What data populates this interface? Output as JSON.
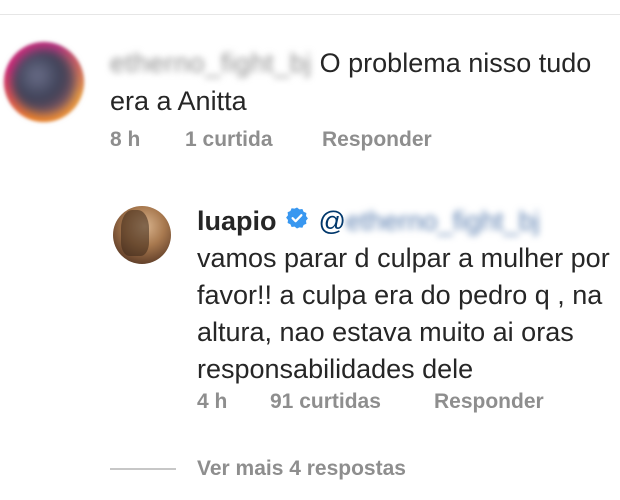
{
  "comment": {
    "username": "etherno_fight_bj",
    "text": "O problema nisso tudo era a Anitta",
    "time": "8 h",
    "likes": "1 curtida",
    "reply_label": "Responder"
  },
  "reply": {
    "username": "luapio",
    "mention": "@etherno_fight_bj",
    "text": "vamos parar d culpar a mulher por favor!! a culpa era do pedro q , na altura, nao estava muito ai oras responsabilidades dele",
    "time": "4 h",
    "likes": "91 curtidas",
    "reply_label": "Responder"
  },
  "view_more": "Ver mais 4 respostas",
  "colors": {
    "verified": "#3897f0",
    "meta": "#8e8e8e",
    "mention": "#00376b"
  },
  "icons": {
    "verified": "verified-badge-icon"
  }
}
